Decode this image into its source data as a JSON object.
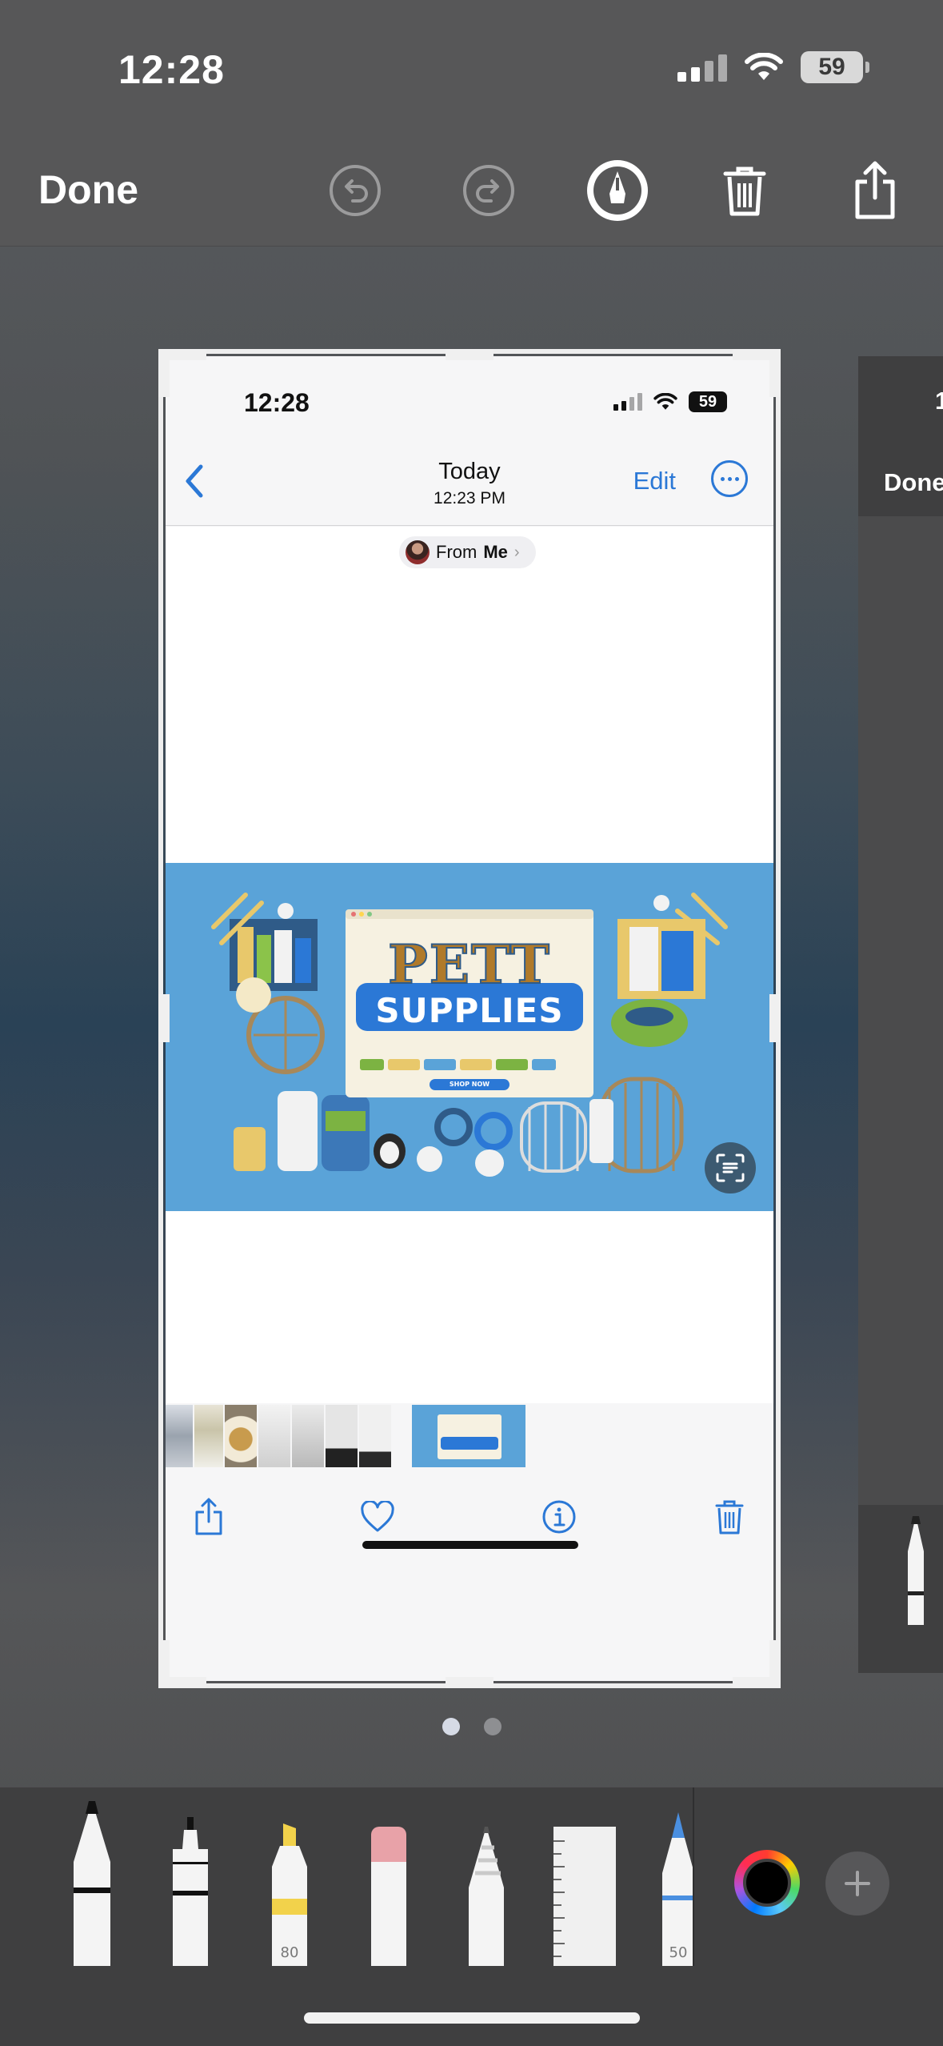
{
  "status_bar": {
    "time": "12:28",
    "battery": "59"
  },
  "toolbar": {
    "done_label": "Done",
    "icons": [
      "undo-icon",
      "redo-icon",
      "markup-pen-icon",
      "trash-icon",
      "share-icon"
    ]
  },
  "screenshot": {
    "status_bar": {
      "time": "12:28",
      "battery": "59"
    },
    "nav": {
      "title": "Today",
      "subtitle": "12:23 PM",
      "edit_label": "Edit"
    },
    "from_pill": {
      "prefix": "From",
      "name": "Me"
    },
    "artwork": {
      "title_line1": "PETT",
      "title_line2": "SUPPLIES",
      "cta": "SHOP NOW"
    },
    "actions": [
      "share-icon",
      "heart-icon",
      "info-icon",
      "trash-icon"
    ]
  },
  "peek": {
    "time_fragment": "1",
    "done_label": "Done"
  },
  "pager": {
    "count": 2,
    "active": 0
  },
  "palette": {
    "tools": [
      {
        "name": "pen",
        "label": ""
      },
      {
        "name": "monoline",
        "label": ""
      },
      {
        "name": "highlighter",
        "label": "80"
      },
      {
        "name": "eraser",
        "label": ""
      },
      {
        "name": "pencil",
        "label": ""
      },
      {
        "name": "ruler",
        "label": ""
      },
      {
        "name": "crayon",
        "label": "50"
      }
    ],
    "colors": {
      "accent": "#2b78d6",
      "highlighter": "#f2d24b",
      "crayon": "#4a8fe0",
      "eraser": "#e8a2a8"
    }
  }
}
